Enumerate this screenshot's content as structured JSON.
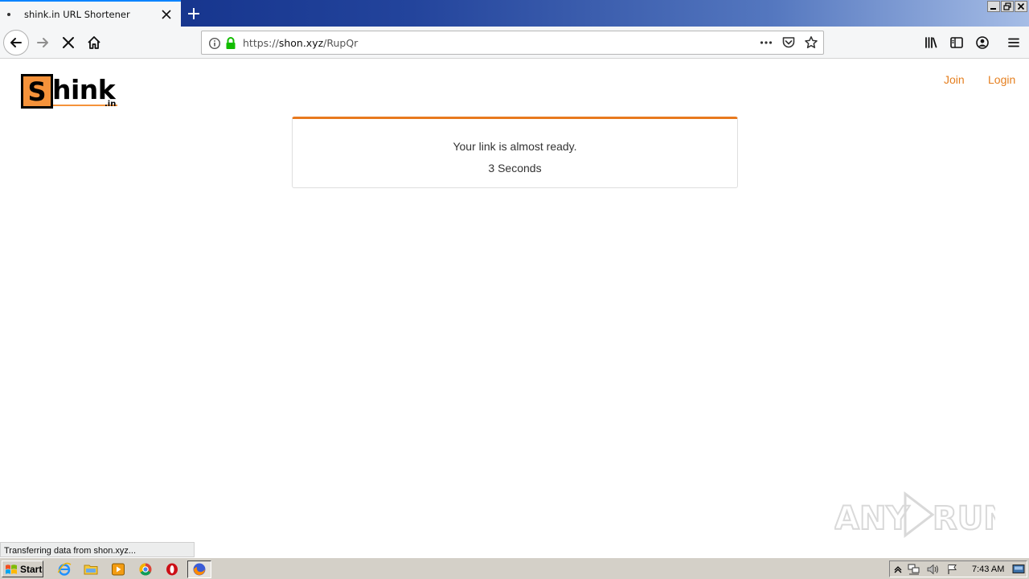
{
  "browser": {
    "tab": {
      "title": "shink.in URL Shortener"
    },
    "url": {
      "scheme": "https://",
      "host": "shon.xyz",
      "path": "/RupQr"
    }
  },
  "page": {
    "logo": {
      "letter": "S",
      "rest": "hink",
      "tld": ".in"
    },
    "nav": {
      "join": "Join",
      "login": "Login"
    },
    "card": {
      "message": "Your link is almost ready.",
      "countdown": "3 Seconds"
    },
    "accent_color": "#e8791e"
  },
  "statusbar": {
    "text": "Transferring data from shon.xyz..."
  },
  "watermark": {
    "text": "ANY RUN"
  },
  "taskbar": {
    "start_label": "Start",
    "clock": "7:43 AM"
  }
}
